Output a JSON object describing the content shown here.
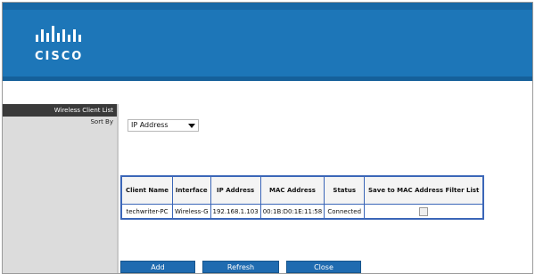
{
  "brand": {
    "wordmark": "CISCO"
  },
  "sidebar": {
    "section_title": "Wireless Client List",
    "sort_label": "Sort By"
  },
  "sort": {
    "selected": "IP Address"
  },
  "table": {
    "headers": [
      "Client Name",
      "Interface",
      "IP Address",
      "MAC Address",
      "Status",
      "Save to MAC Address Filter List"
    ],
    "rows": [
      [
        "techwriter-PC",
        "Wireless-G",
        "192.168.1.103",
        "00:1B:D0:1E:11:58",
        "Connected"
      ]
    ]
  },
  "buttons": {
    "add": "Add",
    "refresh": "Refresh",
    "close": "Close"
  }
}
